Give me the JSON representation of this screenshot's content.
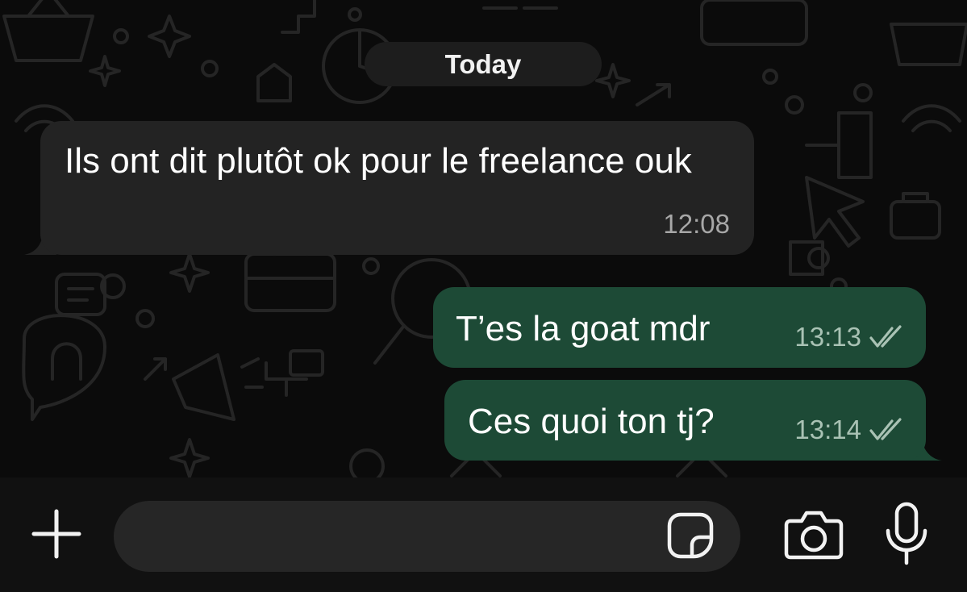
{
  "chat": {
    "date_separator": "Today",
    "messages": [
      {
        "direction": "incoming",
        "text": "Ils ont dit plutôt ok pour le freelance ouk",
        "time": "12:08"
      },
      {
        "direction": "outgoing",
        "text": "T’es la goat mdr",
        "time": "13:13",
        "status": "read"
      },
      {
        "direction": "outgoing",
        "text": "Ces quoi ton tj?",
        "time": "13:14",
        "status": "read"
      }
    ]
  },
  "composer": {
    "placeholder": "",
    "icons": [
      "plus-icon",
      "sticker-icon",
      "camera-icon",
      "microphone-icon"
    ]
  },
  "colors": {
    "background": "#0b0b0b",
    "incoming_bubble": "#232323",
    "outgoing_bubble": "#1d4a36",
    "meta_text": "#a7a7a7"
  }
}
